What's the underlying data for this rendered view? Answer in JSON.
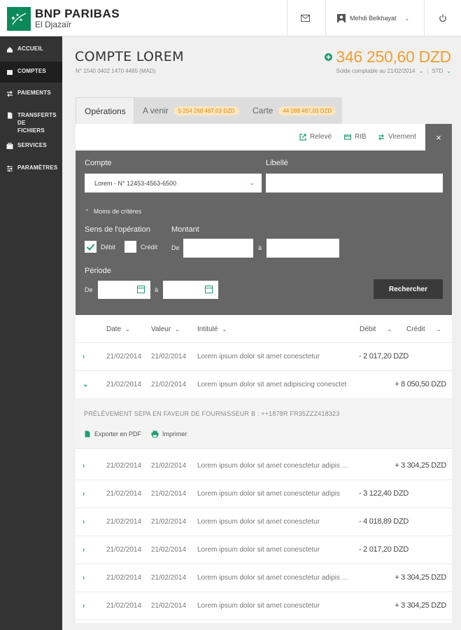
{
  "header": {
    "brand": "BNP PARIBAS",
    "brand_sub": "El Djazaïr",
    "user_name": "Mehdi Belkhayat"
  },
  "sidebar": {
    "items": [
      {
        "label": "ACCUEIL",
        "icon": "home-icon"
      },
      {
        "label": "COMPTES",
        "icon": "wallet-icon"
      },
      {
        "label": "PAIEMENTS",
        "icon": "transfer-icon"
      },
      {
        "label": "TRANSFERTS DE FICHIERS",
        "icon": "file-icon"
      },
      {
        "label": "SERVICES",
        "icon": "services-icon"
      },
      {
        "label": "PARAMÈTRES",
        "icon": "settings-icon"
      }
    ]
  },
  "account": {
    "title": "COMPTE LOREM",
    "number": "N° 1540 0402 1470 4465 (MAD)",
    "balance": "346 250,60 DZD",
    "balance_date": "Solde comptable au 21/02/2014",
    "balance_mode": "STD"
  },
  "tabs": [
    {
      "label": "Opérations",
      "badge": ""
    },
    {
      "label": "A venir",
      "badge": "5 254 268 487,03 DZD"
    },
    {
      "label": "Carte",
      "badge": "44 288 487,03 DZD"
    }
  ],
  "actions": {
    "releve": "Relevé",
    "rib": "RIB",
    "virement": "Virement",
    "close": "×"
  },
  "filters": {
    "compte_label": "Compte",
    "compte_value": "Lorem - N° 12453-4563-6500",
    "libelle_label": "Libellé",
    "criteria_toggle": "Moins de critères",
    "sens_label": "Sens de l'opération",
    "debit_label": "Débit",
    "credit_label": "Crédit",
    "montant_label": "Montant",
    "de": "De",
    "a": "à",
    "periode_label": "Période",
    "search_button": "Rechercher"
  },
  "table": {
    "headers": {
      "date": "Date",
      "valeur": "Valeur",
      "intitule": "Intitulé",
      "debit": "Débit",
      "credit": "Crédit"
    },
    "rows": [
      {
        "date": "21/02/2014",
        "valeur": "21/02/2014",
        "label": "Lorem ipsum dolor sit amet conesctetur",
        "debit": "- 2 017,20 DZD",
        "credit": "",
        "expanded": false
      },
      {
        "date": "21/02/2014",
        "valeur": "21/02/2014",
        "label": "Lorem ipsum dolor sit amet adipiscing conesctet",
        "debit": "",
        "credit": "+ 8 050,50 DZD",
        "expanded": true
      },
      {
        "date": "21/02/2014",
        "valeur": "21/02/2014",
        "label": "Lorem ipsum dolor sit amet conesctetur adipis ...",
        "debit": "",
        "credit": "+ 3 304,25 DZD",
        "expanded": false
      },
      {
        "date": "21/02/2014",
        "valeur": "21/02/2014",
        "label": "Lorem ipsum dolor sit amet conesctetur adipis",
        "debit": "- 3 122,40 DZD",
        "credit": "",
        "expanded": false
      },
      {
        "date": "21/02/2014",
        "valeur": "21/02/2014",
        "label": "Lorem ipsum dolor sit amet conesctetur",
        "debit": "- 4 018,89 DZD",
        "credit": "",
        "expanded": false
      },
      {
        "date": "21/02/2014",
        "valeur": "21/02/2014",
        "label": "Lorem ipsum dolor sit amet conesctetur",
        "debit": "- 2 017,20 DZD",
        "credit": "",
        "expanded": false
      },
      {
        "date": "21/02/2014",
        "valeur": "21/02/2014",
        "label": "Lorem ipsum dolor sit amet conesctetur adipis ...",
        "debit": "",
        "credit": "+ 3 304,25 DZD",
        "expanded": false
      },
      {
        "date": "21/02/2014",
        "valeur": "21/02/2014",
        "label": "Lorem ipsum dolor sit amet conesctetur",
        "debit": "",
        "credit": "+ 3 304,25 DZD",
        "expanded": false
      }
    ],
    "detail": {
      "text": "PRÉLÈVEMENT SEPA EN FAVEUR DE FOURNISSEUR B : ++1878R FR35ZZZ418323",
      "export_pdf": "Exporter en PDF",
      "print": "Imprimer"
    }
  },
  "colors": {
    "accent": "#1f9e6e",
    "balance": "#f0a030",
    "sidebar": "#333333",
    "filter_bg": "#666666"
  }
}
